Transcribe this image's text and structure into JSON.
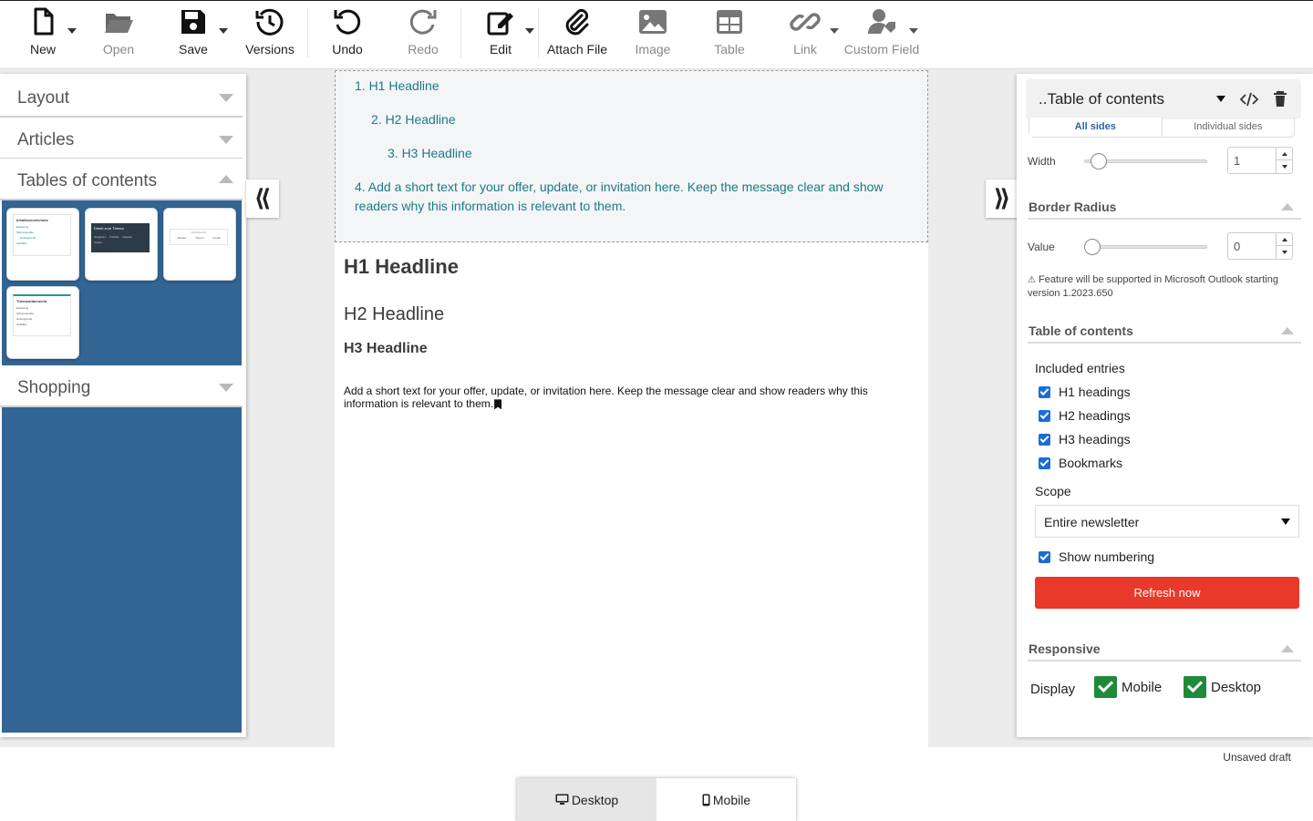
{
  "toolbar": {
    "buttons": [
      {
        "label": "New",
        "icon": "file-icon",
        "disabled": false
      },
      {
        "label": "Open",
        "icon": "folder-icon",
        "disabled": true
      },
      {
        "label": "Save",
        "icon": "floppy-disk-icon",
        "disabled": false
      },
      {
        "label": "Versions",
        "icon": "history-icon",
        "disabled": false
      },
      {
        "label": "Undo",
        "icon": "undo-icon",
        "disabled": false
      },
      {
        "label": "Redo",
        "icon": "redo-icon",
        "disabled": true
      },
      {
        "label": "Edit",
        "icon": "pencil-icon",
        "disabled": false
      },
      {
        "label": "Attach File",
        "icon": "paperclip-icon",
        "disabled": false
      },
      {
        "label": "Image",
        "icon": "image-icon",
        "disabled": true
      },
      {
        "label": "Table",
        "icon": "table-icon",
        "disabled": true
      },
      {
        "label": "Link",
        "icon": "link-icon",
        "disabled": true
      },
      {
        "label": "Custom Field",
        "icon": "user-tag-icon",
        "disabled": true
      }
    ]
  },
  "left_panel": {
    "sections": [
      {
        "label": "Layout",
        "expanded": false
      },
      {
        "label": "Articles",
        "expanded": false
      },
      {
        "label": "Tables of contents",
        "expanded": true
      },
      {
        "label": "Shopping",
        "expanded": false
      }
    ],
    "thumbnails": {
      "t1_title": "Inhaltsverzeichnis",
      "t1_lines": [
        "Einleitung",
        "Schwerpunkte",
        "Hintergründe",
        "Ausblick"
      ],
      "t2_title": "Direkt zum Thema",
      "t2_lines": [
        "Neuigkeiten",
        "Produkte",
        "Angebote",
        "Kontakt"
      ],
      "t3_title": "Inhaltsübersicht",
      "t3_lines": [
        "Aktuelles",
        "Themen",
        "Kontakt"
      ],
      "t4_title": "Themenübersicht",
      "t4_lines": [
        "Einleitung",
        "Schwerpunkte",
        "Hintergründe",
        "Ausblick"
      ]
    }
  },
  "collapse": {
    "left": "⟪",
    "right": "⟫"
  },
  "canvas": {
    "toc": [
      "1. H1 Headline",
      "2. H2 Headline",
      "3. H3 Headline",
      "4. Add a short text for your offer, update, or invitation here. Keep the message clear and show readers why this information is relevant to them."
    ],
    "h1": "H1 Headline",
    "h2": "H2 Headline",
    "h3": "H3 Headline",
    "paragraph": "Add a short text for your offer, update, or invitation here. Keep the message clear and show readers why this information is relevant to them."
  },
  "right_panel": {
    "title": "..Table of contents",
    "border_tabs": [
      "All sides",
      "Individual sides"
    ],
    "width_label": "Width",
    "width_value": "1",
    "border_radius": {
      "title": "Border Radius",
      "value_label": "Value",
      "value": "0",
      "note": "Feature will be supported in Microsoft Outlook starting version 1.2023.650"
    },
    "toc_section": {
      "title": "Table of contents",
      "included_label": "Included entries",
      "entries": [
        {
          "label": "H1 headings",
          "checked": true
        },
        {
          "label": "H2 headings",
          "checked": true
        },
        {
          "label": "H3 headings",
          "checked": true
        },
        {
          "label": "Bookmarks",
          "checked": true
        }
      ],
      "scope_label": "Scope",
      "scope_value": "Entire newsletter",
      "show_numbering": "Show numbering",
      "refresh_label": "Refresh now"
    },
    "responsive": {
      "title": "Responsive",
      "display_label": "Display",
      "mobile": "Mobile",
      "desktop": "Desktop"
    }
  },
  "status": "Unsaved draft",
  "view_switch": {
    "desktop": "Desktop",
    "mobile": "Mobile",
    "active": "Desktop"
  },
  "colors": {
    "accent_blue": "#326593",
    "toc_teal": "#1d7a86",
    "refresh_red": "#e8392a",
    "check_green": "#1f8a3a",
    "checkbox_blue": "#1c6cd8"
  }
}
